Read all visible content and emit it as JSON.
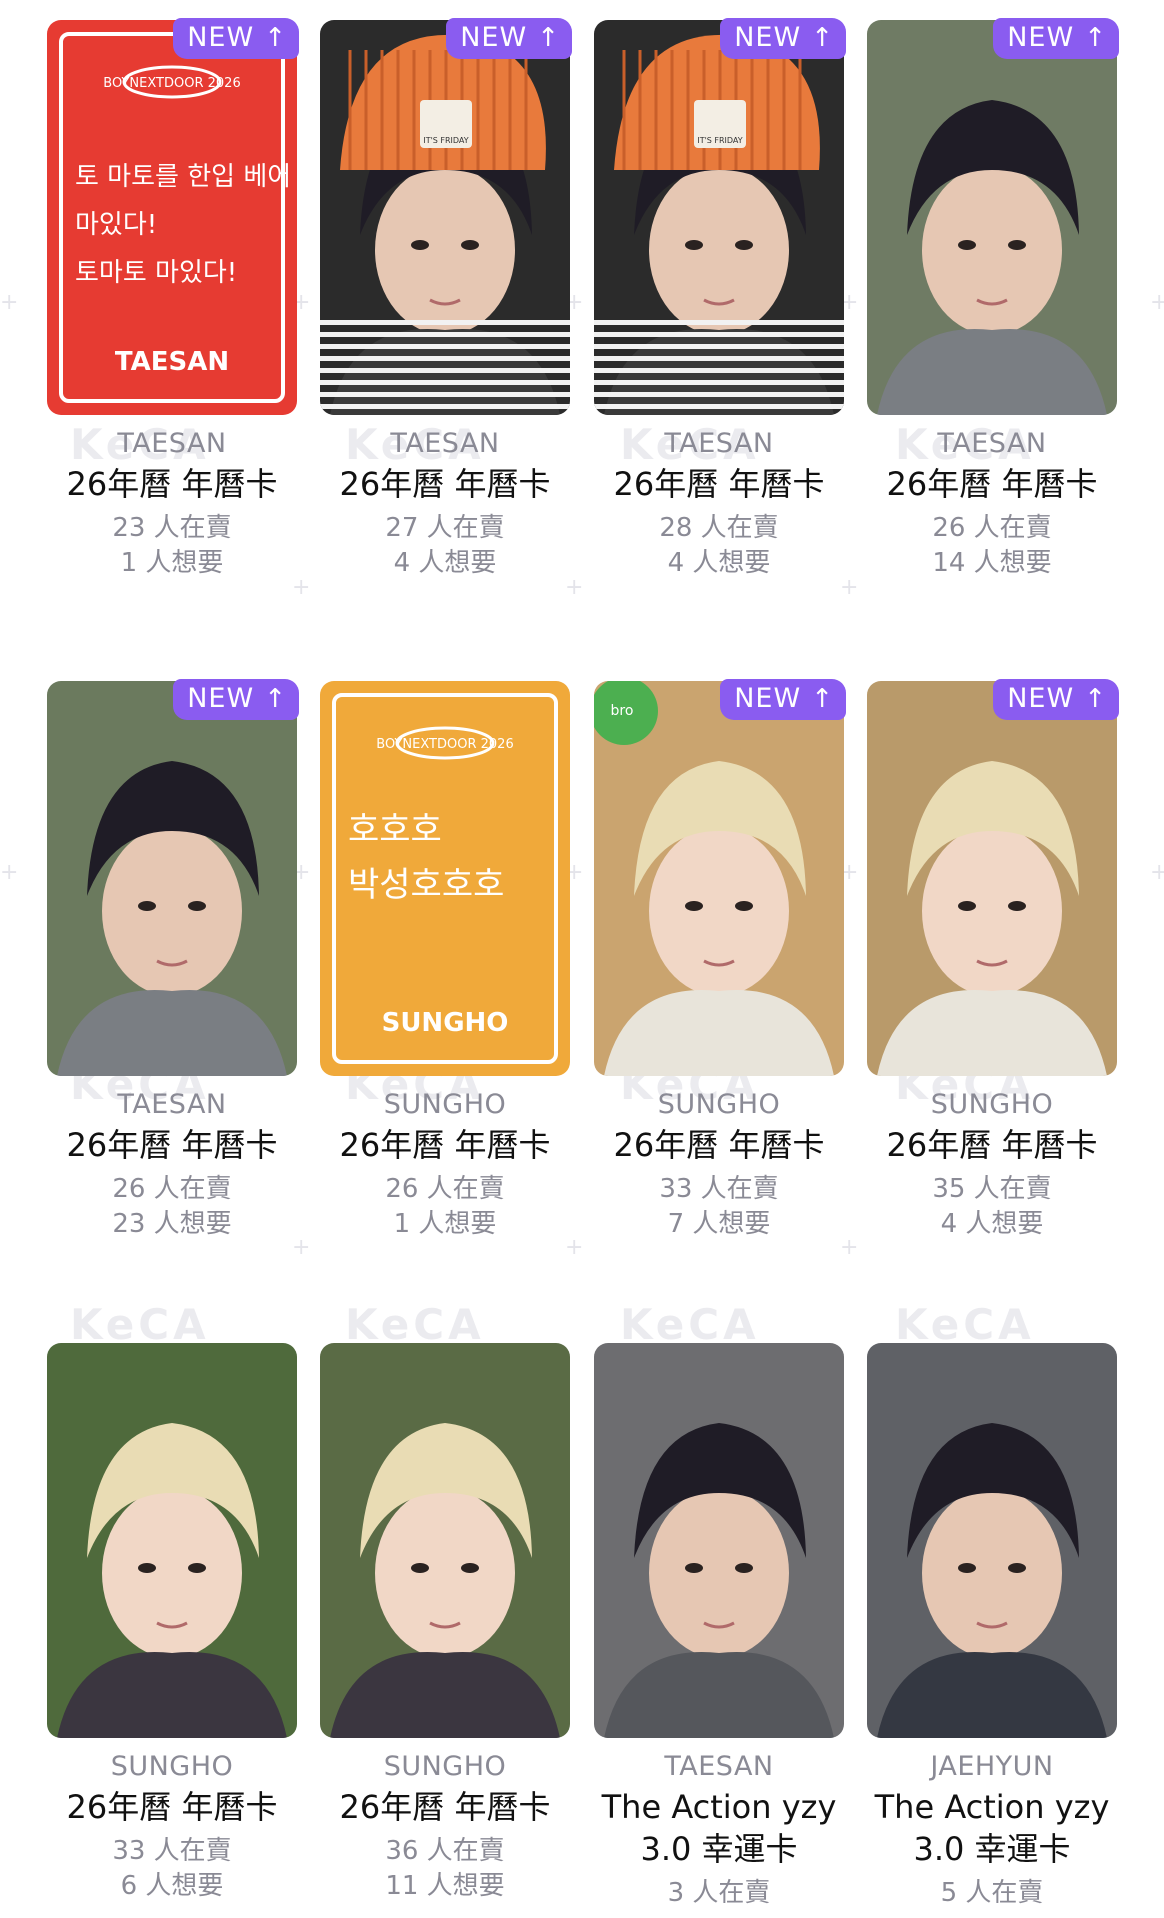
{
  "watermark": "KeCA",
  "badge": {
    "label": "NEW",
    "arrow": "↑"
  },
  "cards": [
    {
      "member": "TAESAN",
      "title": "26年曆 年曆卡",
      "title2": "",
      "sellers": "23 人在賣",
      "wanted": "1 人想要",
      "new": true,
      "card_text": "TAESAN",
      "handwriting": [
        "토 마토를 한입 베어 물고",
        "마있다!",
        "토마토 마있다!"
      ],
      "logo": "BOYNEXTDOOR 2026",
      "bg": "#e63b32"
    },
    {
      "member": "TAESAN",
      "title": "26年曆 年曆卡",
      "title2": "",
      "sellers": "27 人在賣",
      "wanted": "4 人想要",
      "new": true,
      "hat_text": "IT'S FRIDAY",
      "bg": "#2b2b2b"
    },
    {
      "member": "TAESAN",
      "title": "26年曆 年曆卡",
      "title2": "",
      "sellers": "28 人在賣",
      "wanted": "4 人想要",
      "new": true,
      "hat_text": "IT'S FRIDAY",
      "bg": "#2b2b2b"
    },
    {
      "member": "TAESAN",
      "title": "26年曆 年曆卡",
      "title2": "",
      "sellers": "26 人在賣",
      "wanted": "14 人想要",
      "new": true,
      "bg": "#6f7b64"
    },
    {
      "member": "TAESAN",
      "title": "26年曆 年曆卡",
      "title2": "",
      "sellers": "26 人在賣",
      "wanted": "23 人想要",
      "new": true,
      "bg": "#6b7a5e"
    },
    {
      "member": "SUNGHO",
      "title": "26年曆 年曆卡",
      "title2": "",
      "sellers": "26 人在賣",
      "wanted": "1 人想要",
      "new": false,
      "card_text": "SUNGHO",
      "handwriting": [
        "호호호",
        "박성호호호"
      ],
      "logo": "BOYNEXTDOOR 2026",
      "bg": "#f0a93a"
    },
    {
      "member": "SUNGHO",
      "title": "26年曆 年曆卡",
      "title2": "",
      "sellers": "33 人在賣",
      "wanted": "7 人想要",
      "new": true,
      "sticker": "broccoli",
      "bg": "#caa46f"
    },
    {
      "member": "SUNGHO",
      "title": "26年曆 年曆卡",
      "title2": "",
      "sellers": "35 人在賣",
      "wanted": "4 人想要",
      "new": true,
      "bg": "#b99a6a"
    },
    {
      "member": "SUNGHO",
      "title": "26年曆 年曆卡",
      "title2": "",
      "sellers": "33 人在賣",
      "wanted": "6 人想要",
      "new": false,
      "bg": "#4f6a3c"
    },
    {
      "member": "SUNGHO",
      "title": "26年曆 年曆卡",
      "title2": "",
      "sellers": "36 人在賣",
      "wanted": "11 人想要",
      "new": false,
      "bg": "#5a6b45"
    },
    {
      "member": "TAESAN",
      "title": "The Action yzy",
      "title2": "3.0 幸運卡",
      "sellers": "3 人在賣",
      "wanted": "",
      "new": false,
      "bg": "#6d6d70"
    },
    {
      "member": "JAEHYUN",
      "title": "The Action yzy",
      "title2": "3.0 幸運卡",
      "sellers": "5 人在賣",
      "wanted": "",
      "new": false,
      "bg": "#5f6166"
    }
  ],
  "colors": {
    "accent": "#8a5cf0",
    "muted_text": "#8a8a95",
    "title_text": "#111111"
  }
}
